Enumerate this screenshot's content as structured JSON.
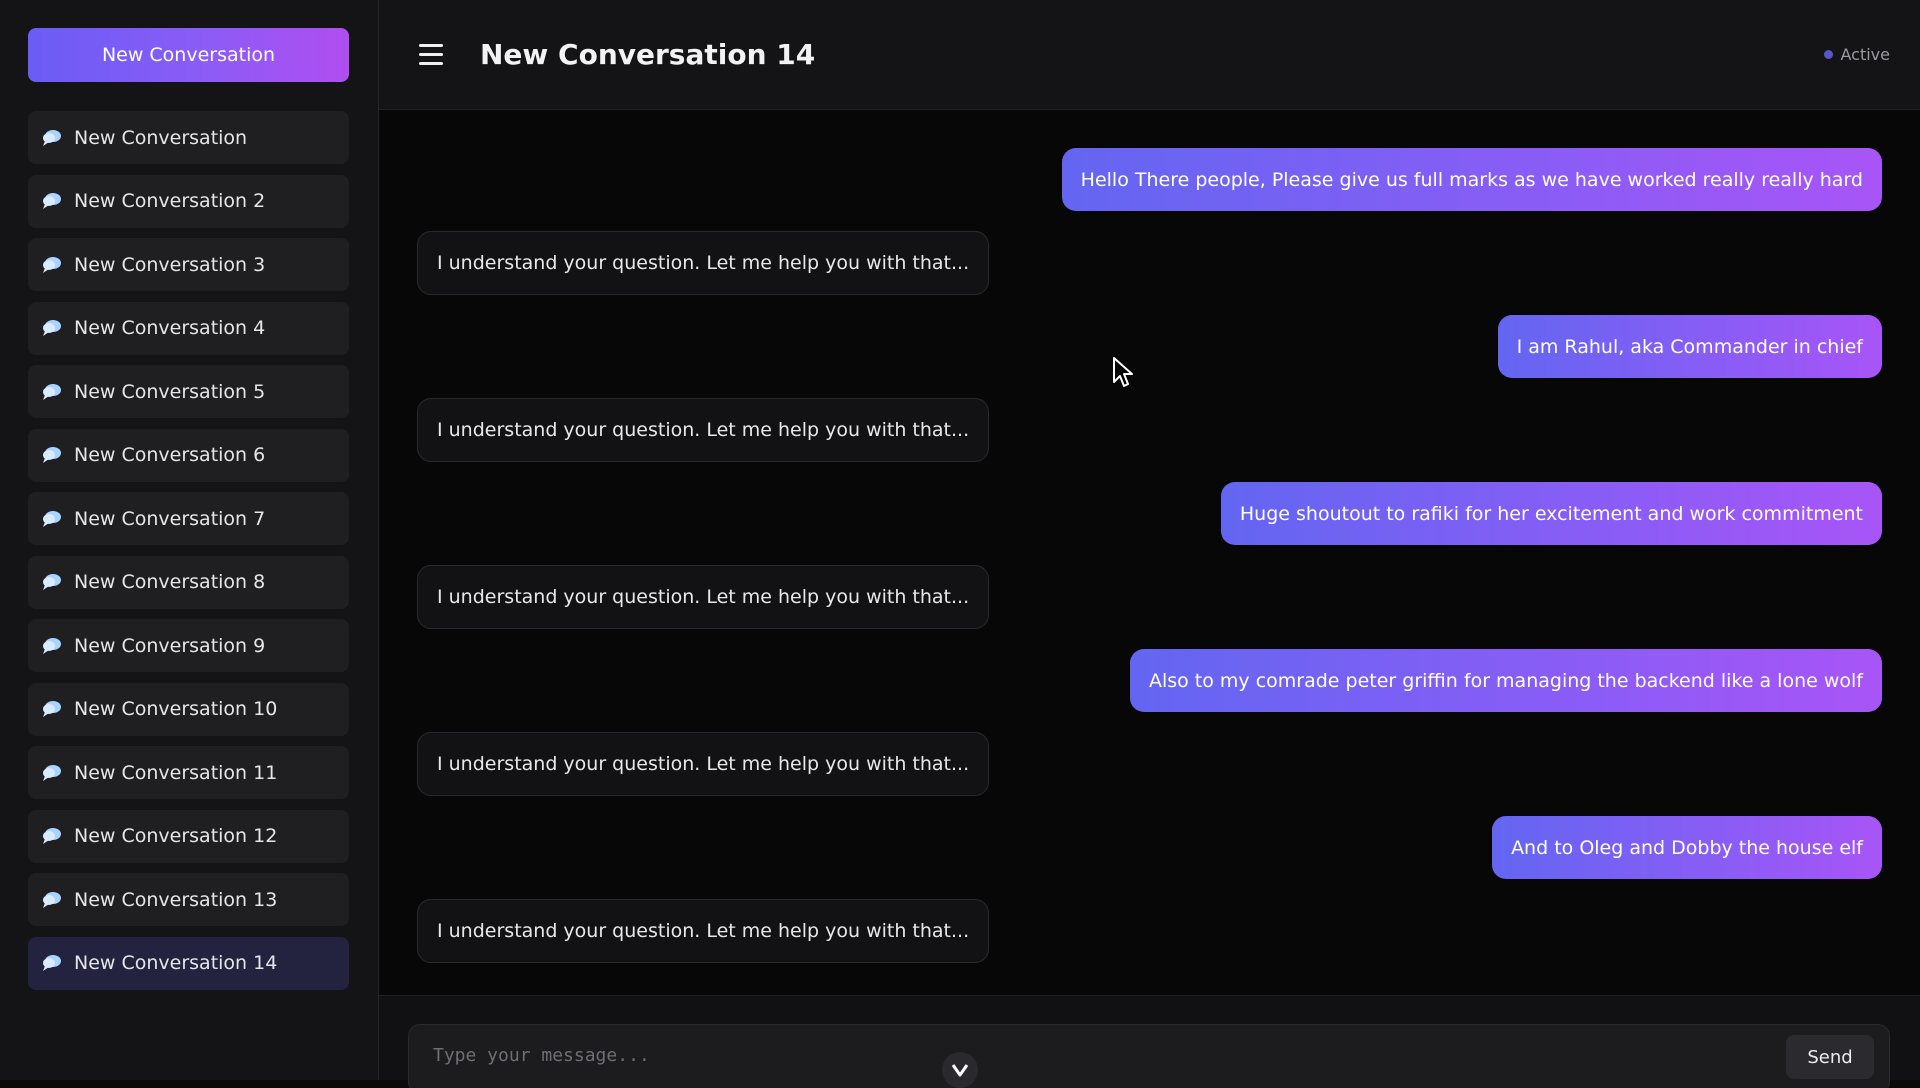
{
  "sidebar": {
    "new_button_label": "New Conversation",
    "conversations": [
      {
        "label": "New Conversation"
      },
      {
        "label": "New Conversation 2"
      },
      {
        "label": "New Conversation 3"
      },
      {
        "label": "New Conversation 4"
      },
      {
        "label": "New Conversation 5"
      },
      {
        "label": "New Conversation 6"
      },
      {
        "label": "New Conversation 7"
      },
      {
        "label": "New Conversation 8"
      },
      {
        "label": "New Conversation 9"
      },
      {
        "label": "New Conversation 10"
      },
      {
        "label": "New Conversation 11"
      },
      {
        "label": "New Conversation 12"
      },
      {
        "label": "New Conversation 13"
      },
      {
        "label": "New Conversation 14",
        "active": true
      }
    ]
  },
  "header": {
    "title": "New Conversation 14",
    "status": "Active"
  },
  "messages": [
    {
      "role": "user",
      "text": "Hello There people, Please give us full marks as we have worked really really hard"
    },
    {
      "role": "assistant",
      "text": "I understand your question. Let me help you with that..."
    },
    {
      "role": "user",
      "text": "I am Rahul, aka Commander in chief"
    },
    {
      "role": "assistant",
      "text": "I understand your question. Let me help you with that..."
    },
    {
      "role": "user",
      "text": "Huge shoutout to rafiki for her excitement and work commitment"
    },
    {
      "role": "assistant",
      "text": "I understand your question. Let me help you with that..."
    },
    {
      "role": "user",
      "text": "Also to my comrade peter griffin for managing the backend like a lone wolf"
    },
    {
      "role": "assistant",
      "text": "I understand your question. Let me help you with that..."
    },
    {
      "role": "user",
      "text": "And to Oleg and Dobby the house elf"
    },
    {
      "role": "assistant",
      "text": "I understand your question. Let me help you with that..."
    }
  ],
  "composer": {
    "placeholder": "Type your message...",
    "value": "",
    "send_label": "Send"
  },
  "icons": {
    "conversation": "speech-bubble-icon",
    "menu": "hamburger-menu-icon",
    "scroll": "chevron-down-icon"
  },
  "colors": {
    "accent_start": "#6366f1",
    "accent_end": "#a855f7",
    "status_dot": "#5a55c8"
  }
}
